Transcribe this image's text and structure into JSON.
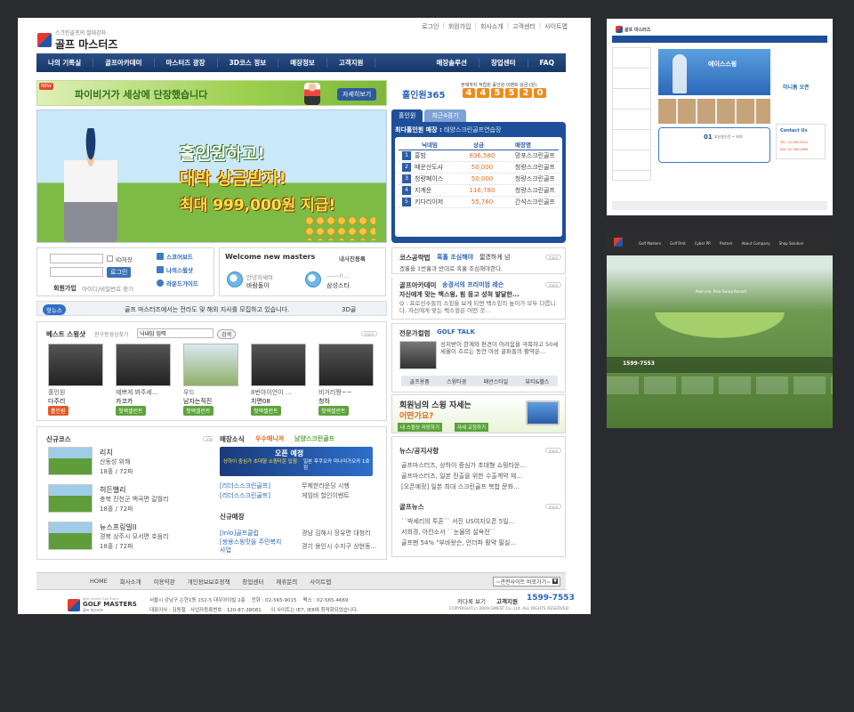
{
  "topnav": [
    "로그인",
    "회원가입",
    "회사소개",
    "고객센터",
    "사이트맵"
  ],
  "logo": {
    "sub": "스크린골프의 절대강자",
    "main": "골프 마스터즈"
  },
  "mainnav": [
    "나의 기록실",
    "골프아카데미",
    "마스터즈 광장",
    "3D코스 정보",
    "매장정보",
    "고객지원",
    "매장솔루션",
    "창업센터",
    "FAQ"
  ],
  "banner_top": {
    "text": "파이비거가 세상에 단장했습니다",
    "button": "자세히보기",
    "badge": "NEW"
  },
  "holeinone": {
    "label": "홀인원365",
    "caption": "현재까지 적립된 홀인원 이벤트 상금 (원)",
    "digits": [
      "4",
      "4",
      "5",
      "5",
      "2",
      "0"
    ]
  },
  "hero": {
    "line1": "홀인원하고!",
    "line2": "대박 상금받자!",
    "line3": "최대 999,000원 지급!"
  },
  "rank_panel": {
    "tabs": [
      "홀인원",
      "최근4경기"
    ],
    "store_label": "최다홀인원 매장 :",
    "store_name": "태양스크린골프연습장",
    "headers": [
      "닉네임",
      "상금",
      "매장명"
    ],
    "rows": [
      {
        "n": "1",
        "nick": "홍밤",
        "prize": "836,580",
        "store": "망포스크린골프"
      },
      {
        "n": "2",
        "nick": "때운산도사",
        "prize": "50,000",
        "store": "청량스크린골프"
      },
      {
        "n": "3",
        "nick": "청량페이스",
        "prize": "50,000",
        "store": "청량스크린골프"
      },
      {
        "n": "4",
        "nick": "지계운",
        "prize": "116,780",
        "store": "청량스크린골프"
      },
      {
        "n": "5",
        "nick": "키다리아저",
        "prize": "55,760",
        "store": "간석스크린골프"
      }
    ]
  },
  "login": {
    "save_id": "ID저장",
    "button": "로그인",
    "join": "회원가입",
    "find": "아이디/비밀번호 찾기",
    "links": [
      "스코어보드",
      "나의스윙샷",
      "라운드가이드"
    ]
  },
  "welcome": {
    "title": "Welcome new masters",
    "sub": "내사진등록",
    "users": [
      {
        "greet": "안녕하세여",
        "name": "바람돌이"
      },
      {
        "greet": "------!!...",
        "name": "삼성스타"
      }
    ]
  },
  "ticker": {
    "badge": "핫뉴스",
    "text": "골프 마스터즈에서는 전라도 및 해외 지사를 모집하고 있습니다.",
    "right": "3D골"
  },
  "best_swing": {
    "title": "베스트 스윙샷",
    "sub": "친구동영상찾기",
    "input_value": "닉내임 입력",
    "search": "검색",
    "items": [
      {
        "cap": "홀인원",
        "name": "다주리",
        "tag": "홀인원",
        "tagtype": "red"
      },
      {
        "cap": "예쁘게 봐주세...",
        "name": "카코카",
        "tag": "첫엑셀런트",
        "tagtype": "green"
      },
      {
        "cap": "우드",
        "name": "남자는직진",
        "tag": "첫엑셀런트",
        "tagtype": "green"
      },
      {
        "cap": "8번아이언이 ...",
        "name": "치면08",
        "tag": "첫엑셀런트",
        "tagtype": "green"
      },
      {
        "cap": "비거리짱~~",
        "name": "청하",
        "tag": "첫엑셀런트",
        "tagtype": "green"
      }
    ]
  },
  "new_course": {
    "title": "신규코스",
    "items": [
      {
        "name": "리치",
        "loc": "산동성 위해",
        "holes": "18홀 / 72파"
      },
      {
        "name": "히든밸리",
        "loc": "충북 진천군 백곡면 갈월리",
        "holes": "18홀 / 72파"
      },
      {
        "name": "뉴스프링빌II",
        "loc": "경북 상주시 모서면 호음리",
        "holes": "18홀 / 72파"
      }
    ]
  },
  "store_news": {
    "title": "매장소식",
    "highlight": "우수매니져",
    "highlight_sub": "남양스크린골프",
    "banner_line1": "오픈 예정",
    "banner_line2": "상하이 중심가 초대형 쇼핑타운 입점",
    "banner_line3": "일본 후쿠오카 미나미가오카 1호점",
    "rows": [
      {
        "tag": "[리더스스크린골프]",
        "text": "무제한라운딩 시행"
      },
      {
        "tag": "[리더스스크린골프]",
        "text": "게임비 할인이벤트"
      }
    ],
    "new_title": "신규매장",
    "new_rows": [
      {
        "tag": "[Inlo]골프클럽",
        "text": "경남 김해시 장유면 대청리"
      },
      {
        "tag": "[쌍용스윙맛을 주민복지사업",
        "text": "경기 용인시 수지구 상현동..."
      }
    ]
  },
  "course_guide": {
    "title": "코스공략법",
    "sub": "혹홀 조심해야",
    "sub2": "짧겠하게 넘",
    "body": "겠홀을 1번홀과 반대로 혹홀 조심해야한다."
  },
  "academy": {
    "title": "골프아카데미",
    "sub": "송경서의 프리미엄 레슨",
    "head": "자신에게 맞는 백스윙, 힘 뭉고 성혀 발달한...",
    "body": "Q : 프로선수들의 스윙을 보게 되면 백스윙의 높이가 모두 다릅니다. 자신에게 맞는 백스윙은 어떤 것..."
  },
  "column": {
    "title": "전문가컬럼",
    "sub": "GOLF TALK",
    "body": "성처받이 한계와 편견이 어려움을 극복하고 50세 세월이 흐르는 동안 여성 골퍼들의 활약은...",
    "tabs": [
      "골프용품",
      "스윙타경",
      "패션스타일",
      "뷰티&헬스"
    ]
  },
  "swing_ad": {
    "line1": "회원님의 스윙 자세는",
    "line2": "어떤가요?",
    "b1": "내 스윙샷 자랑하기",
    "b2": "자세 교정하기"
  },
  "news": {
    "title": "뉴스/공지사항",
    "rows": [
      "골프마스터즈, 상하이 중심가 초대형 쇼핑타운...",
      "골프마스터즈, 일본 진출을 위한 수출계약 체...",
      "[오픈예정] 일본 최대 스크린골프 복합 문화..."
    ]
  },
  "golf_news": {
    "title": "골프뉴스",
    "rows": [
      "``박세리의 투혼`` 서진 US여자오픈 5일...",
      "서희경, 아칸소서 ``눈물의 설욕전``",
      "골프팬 54% \"부바왓슨, 언더파 활약 필실..."
    ]
  },
  "footer": {
    "links": [
      "HOME",
      "회사소개",
      "이용약관",
      "개인정보보호정책",
      "창업센터",
      "제휴문의",
      "사이트맵"
    ],
    "related": "~관련사이트 바로가기~",
    "logo_top": "Best Screen Golf Brand",
    "logo_main": "GOLF MASTERS",
    "logo_sub": "골프 마스터즈",
    "addr1": "서울시 강남구 논현1동 152-5 대우아이빌 2층    전화 : 02-565-9015    팩스 : 02-565-4669",
    "addr2": "대표이사 : 김동철   사업자등록번호 : 120-87-38081      이 사이트는 IE7, IE8에 최적화되었습니다.",
    "catalog": "카다록 보기",
    "support": "고객지원",
    "phone": "1599-7553",
    "copyright": "COPYRIGHT(c) 2009 GMEST Co.,Ltd. ALL RIGHTS RESERVED"
  },
  "thumb1": {
    "logo": "골프 마스터즈",
    "banner_title": "에이스스윙",
    "stat": "01",
    "stat_text": "부산승인건 ~ 외치",
    "mini": "미니홈 오픈",
    "contact": "Contact Us",
    "tel": "TEL: 02-565-9015",
    "fax": "FAX: 02-565-4669"
  },
  "thumb2": {
    "nav": [
      "Golf Masters",
      "Golf Rmt",
      "Cyber PR",
      "Partner",
      "About Company",
      "Shop Solution"
    ],
    "slogan": "Real one, Real Swing Round!",
    "phone": "1599-7553"
  }
}
